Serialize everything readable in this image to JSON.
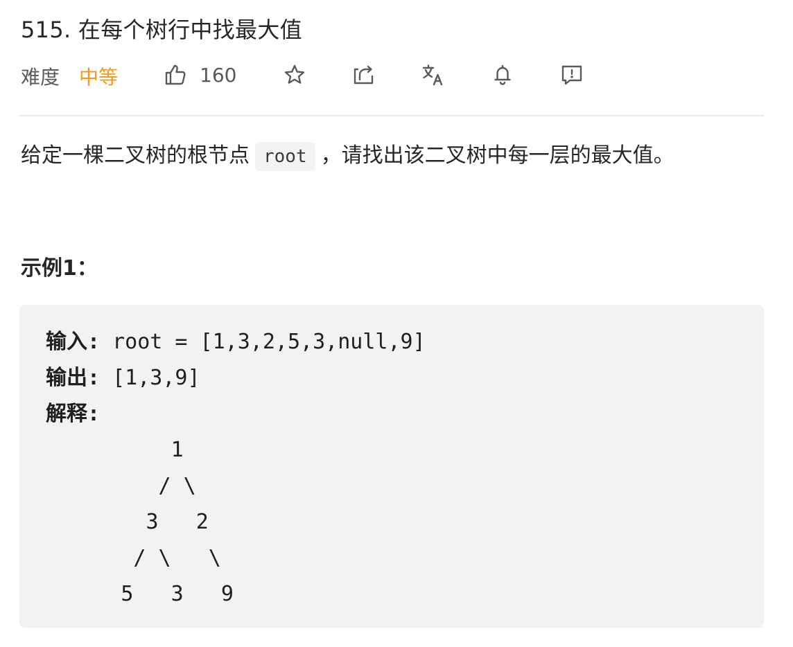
{
  "problem": {
    "title": "515. 在每个树行中找最大值",
    "difficulty_label": "难度",
    "difficulty_value": "中等",
    "likes": "160",
    "accent_color": "#ef9a1a"
  },
  "toolbar": {
    "icons": [
      "thumbs-up-icon",
      "star-icon",
      "share-icon",
      "translate-icon",
      "bell-icon",
      "feedback-icon"
    ]
  },
  "description": {
    "before_code": "给定一棵二叉树的根节点",
    "code": "root",
    "after_code": "，请找出该二叉树中每一层的最大值。"
  },
  "example": {
    "title": "示例1：",
    "input_label": "输入:",
    "input_value": " root = [1,3,2,5,3,null,9]",
    "output_label": "输出:",
    "output_value": " [1,3,9]",
    "explain_label": "解释:",
    "tree_lines": [
      "          1",
      "         / \\",
      "        3   2",
      "       / \\   \\",
      "      5   3   9"
    ]
  }
}
